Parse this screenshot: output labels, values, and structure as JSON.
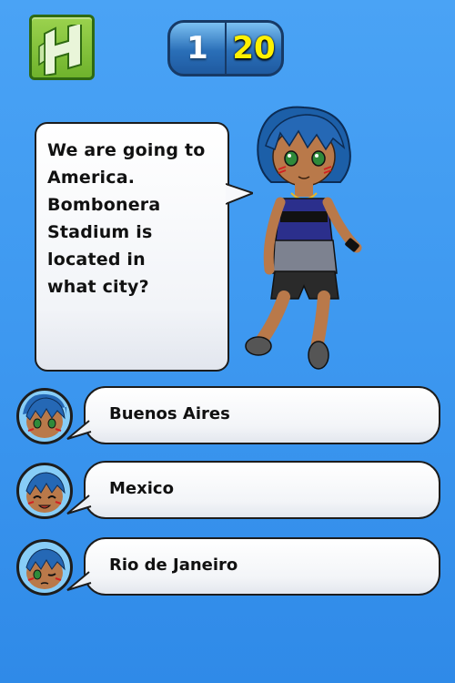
{
  "header": {
    "hint_icon": "hint-h-icon",
    "level": "1",
    "timer": "20"
  },
  "question": {
    "lines": [
      "We are going to",
      "America. Bombonera",
      "Stadium is located in",
      "what city?"
    ]
  },
  "answers": [
    {
      "label": "Buenos Aires",
      "avatar": "avatar-neutral-icon"
    },
    {
      "label": "Mexico",
      "avatar": "avatar-happy-icon"
    },
    {
      "label": "Rio de Janeiro",
      "avatar": "avatar-wink-icon"
    }
  ],
  "colors": {
    "background": "#3d98f0",
    "hint_green": "#6fb32c",
    "timer_yellow": "#fff100",
    "score_blue": "#2a6fb8"
  }
}
